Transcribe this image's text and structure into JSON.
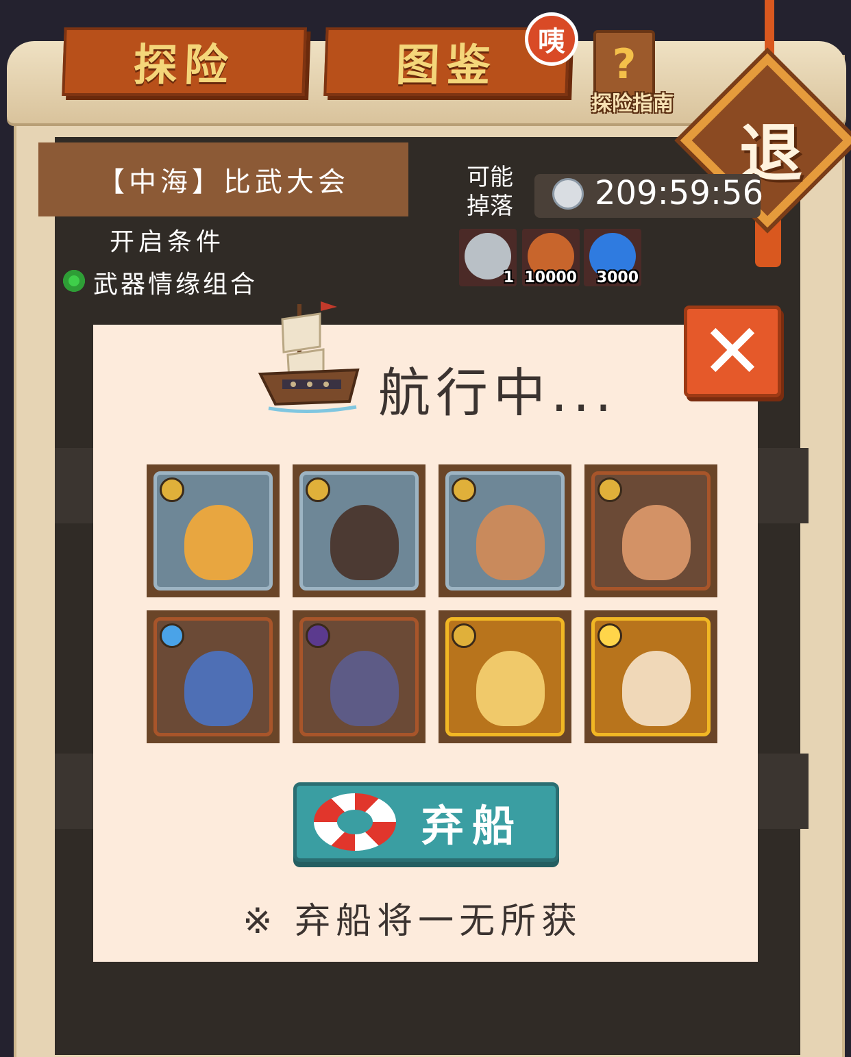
{
  "tabs": {
    "explore": "探险",
    "collection": "图鉴",
    "collection_badge": "咦"
  },
  "guide": {
    "label": "探险指南"
  },
  "exit": {
    "label": "退"
  },
  "stage": {
    "title": "【中海】比武大会",
    "condition_label": "开启条件",
    "condition_item": "武器情缘组合"
  },
  "drops": {
    "label_line1": "可能",
    "label_line2": "掉落",
    "timer": "209:59:56",
    "items": [
      {
        "icon": "blade-icon",
        "count": "1",
        "color": "#b9c0c6"
      },
      {
        "icon": "gold-bag-icon",
        "count": "10000",
        "color": "#c8652c"
      },
      {
        "icon": "blue-flame-icon",
        "count": "3000",
        "color": "#2f7be0"
      }
    ]
  },
  "modal": {
    "title": "航行中...",
    "close_icon": "close-icon",
    "heroes": [
      {
        "icon": "viking-hero-icon",
        "element": "earth",
        "frame": "silver",
        "color": "#e8a640"
      },
      {
        "icon": "samurai-hero-icon",
        "element": "earth",
        "frame": "silver",
        "color": "#4c3a33"
      },
      {
        "icon": "bearded-warrior-icon",
        "element": "earth",
        "frame": "silver",
        "color": "#c98a5c"
      },
      {
        "icon": "bald-brute-icon",
        "element": "earth",
        "frame": "bronze",
        "color": "#d39266"
      },
      {
        "icon": "spiky-monster-icon",
        "element": "water",
        "frame": "bronze",
        "color": "#4e6fb5"
      },
      {
        "icon": "dark-goblin-icon",
        "element": "dark",
        "frame": "bronze",
        "color": "#5d5b86"
      },
      {
        "icon": "fire-goddess-icon",
        "element": "earth",
        "frame": "gold",
        "color": "#f0c96a"
      },
      {
        "icon": "white-monk-icon",
        "element": "light",
        "frame": "gold",
        "color": "#f0d8b8"
      }
    ],
    "abandon_button": "弃船",
    "warning": "※ 弃船将一无所获"
  },
  "colors": {
    "tab": "#b8501a",
    "tab_text": "#f4d67a",
    "modal_bg": "#fdebdc",
    "button": "#3a9ea2",
    "close": "#e5592a"
  }
}
